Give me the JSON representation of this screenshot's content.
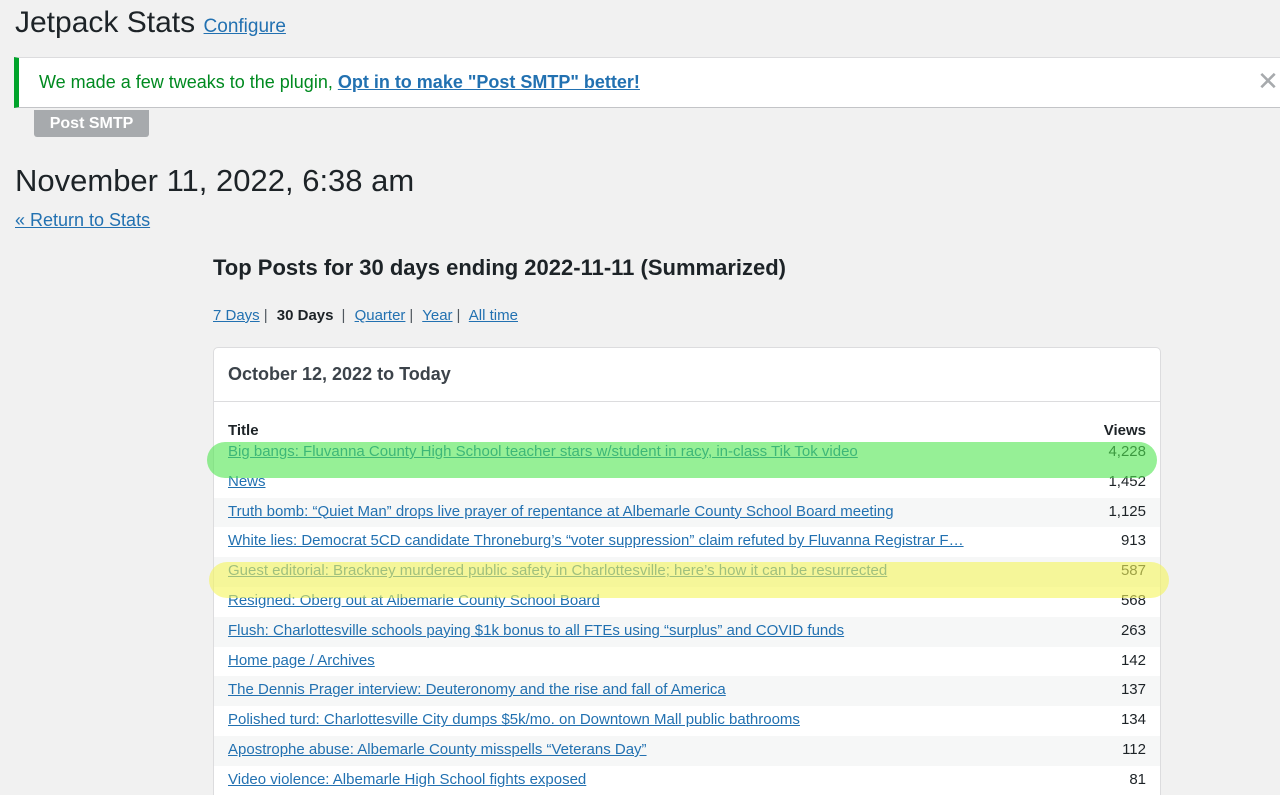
{
  "header": {
    "title": "Jetpack Stats",
    "configure_label": "Configure"
  },
  "notice": {
    "message": "We made a few tweaks to the plugin, ",
    "link_label": "Opt in to make \"Post SMTP\" better!",
    "dismiss_icon": "close-icon",
    "plugin_tag": "Post SMTP",
    "accent_color": "#00a32a"
  },
  "datetime": "November 11, 2022, 6:38 am",
  "return_label": "« Return to Stats",
  "top_title": "Top Posts for 30 days ending 2022-11-11 (Summarized)",
  "periods": {
    "items": [
      {
        "label": "7 Days",
        "current": false
      },
      {
        "label": "30 Days",
        "current": true
      },
      {
        "label": "Quarter",
        "current": false
      },
      {
        "label": "Year",
        "current": false
      },
      {
        "label": "All time",
        "current": false
      }
    ],
    "separator": "|"
  },
  "table": {
    "range": "October 12, 2022 to Today",
    "columns": {
      "title": "Title",
      "views": "Views"
    },
    "rows": [
      {
        "title": "Big bangs: Fluvanna County High School teacher stars w/student in racy, in-class Tik Tok video",
        "views": "4,228"
      },
      {
        "title": "News",
        "views": "1,452"
      },
      {
        "title": "Truth bomb: “Quiet Man” drops live prayer of repentance at Albemarle County School Board meeting",
        "views": "1,125"
      },
      {
        "title": "White lies: Democrat 5CD candidate Throneburg’s “voter suppression” claim refuted by Fluvanna Registrar F…",
        "views": "913"
      },
      {
        "title": "Guest editorial: Brackney murdered public safety in Charlottesville; here’s how it can be resurrected",
        "views": "587"
      },
      {
        "title": "Resigned: Oberg out at Albemarle County School Board",
        "views": "568"
      },
      {
        "title": "Flush: Charlottesville schools paying $1k bonus to all FTEs using “surplus” and COVID funds",
        "views": "263"
      },
      {
        "title": "Home page / Archives",
        "views": "142"
      },
      {
        "title": "The Dennis Prager interview: Deuteronomy and the rise and fall of America",
        "views": "137"
      },
      {
        "title": "Polished turd: Charlottesville City dumps $5k/mo. on Downtown Mall public bathrooms",
        "views": "134"
      },
      {
        "title": "Apostrophe abuse: Albemarle County misspells “Veterans Day”",
        "views": "112"
      },
      {
        "title": "Video violence: Albemarle High School fights exposed",
        "views": "81"
      }
    ]
  },
  "highlights": {
    "green": "#50e650",
    "yellow": "#f5f55a"
  }
}
